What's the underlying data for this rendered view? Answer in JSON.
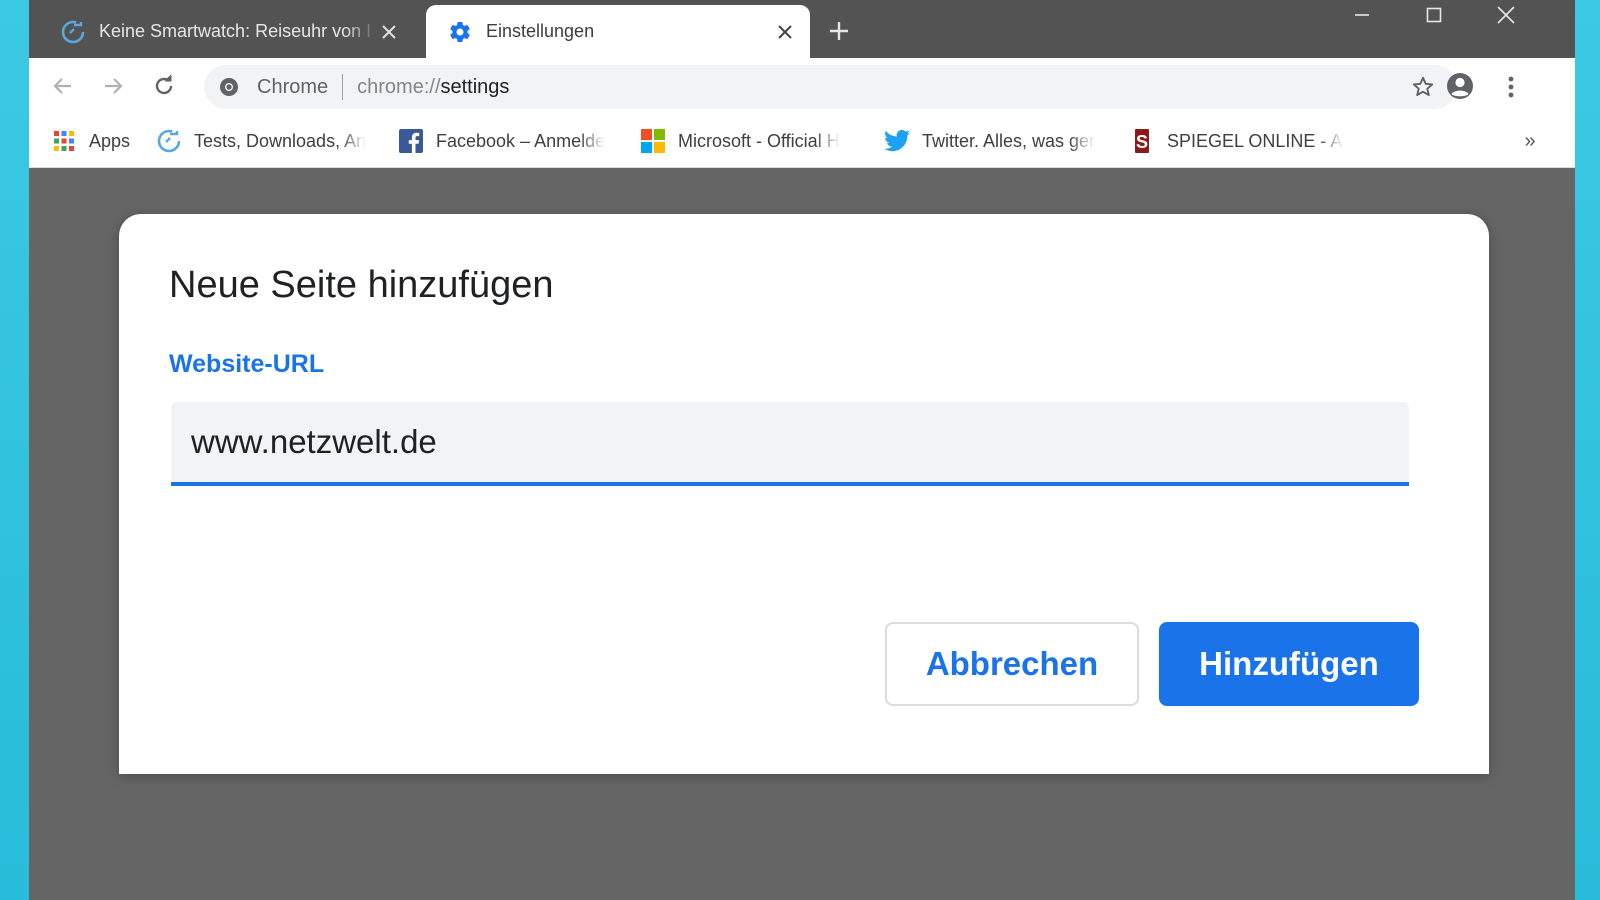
{
  "colors": {
    "accent": "#1a73e8",
    "titlebar": "#535353",
    "overlay": "#656565",
    "desktop": "#2fc3e0"
  },
  "tabs": [
    {
      "title": "Keine Smartwatch: Reiseuhr von I",
      "icon": "refresh-circle-icon",
      "active": false
    },
    {
      "title": "Einstellungen",
      "icon": "gear-icon",
      "active": true
    }
  ],
  "omnibox": {
    "chip": "Chrome",
    "url_scheme": "chrome://",
    "url_path": "settings"
  },
  "bookmarks": [
    {
      "label": "Apps",
      "icon": "apps-grid-icon"
    },
    {
      "label": "Tests, Downloads, An",
      "icon": "refresh-circle-icon"
    },
    {
      "label": "Facebook – Anmelde",
      "icon": "facebook-icon"
    },
    {
      "label": "Microsoft - Official H",
      "icon": "microsoft-icon"
    },
    {
      "label": "Twitter. Alles, was ger",
      "icon": "twitter-icon"
    },
    {
      "label": "SPIEGEL ONLINE - Ak",
      "icon": "spiegel-icon"
    }
  ],
  "bookmarks_more": "»",
  "dialog": {
    "title": "Neue Seite hinzufügen",
    "field_label": "Website-URL",
    "field_value": "www.netzwelt.de",
    "cancel_label": "Abbrechen",
    "confirm_label": "Hinzufügen"
  }
}
